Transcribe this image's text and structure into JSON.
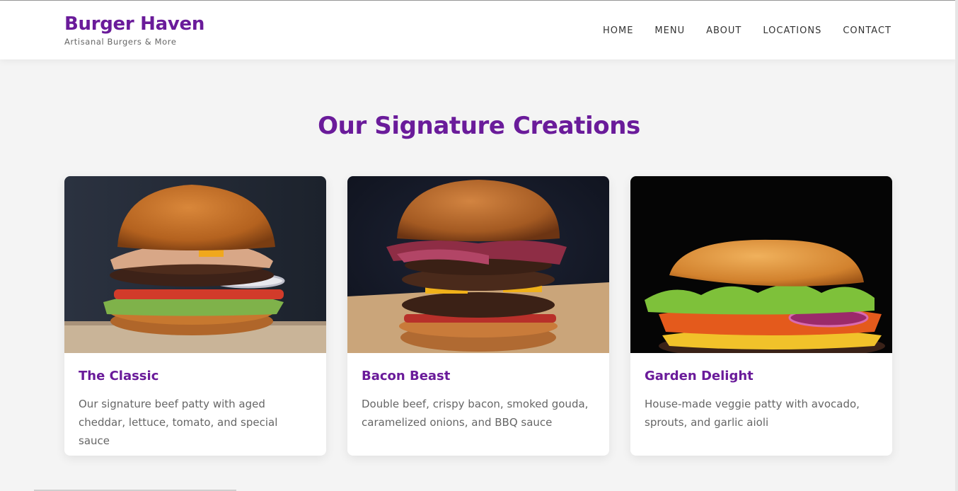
{
  "brand": {
    "name": "Burger Haven",
    "tagline": "Artisanal Burgers & More"
  },
  "nav": {
    "items": [
      "HOME",
      "MENU",
      "ABOUT",
      "LOCATIONS",
      "CONTACT"
    ]
  },
  "section": {
    "title": "Our Signature Creations"
  },
  "cards": [
    {
      "title": "The Classic",
      "description": "Our signature beef patty with aged cheddar, lettuce, tomato, and special sauce",
      "image": "classic-burger-photo"
    },
    {
      "title": "Bacon Beast",
      "description": "Double beef, crispy bacon, smoked gouda, caramelized onions, and BBQ sauce",
      "image": "bacon-burger-photo"
    },
    {
      "title": "Garden Delight",
      "description": "House-made veggie patty with avocado, sprouts, and garlic aioli",
      "image": "veggie-burger-photo"
    }
  ],
  "colors": {
    "brand": "#6a1b9a",
    "background": "#f4f4f4",
    "card": "#ffffff"
  }
}
